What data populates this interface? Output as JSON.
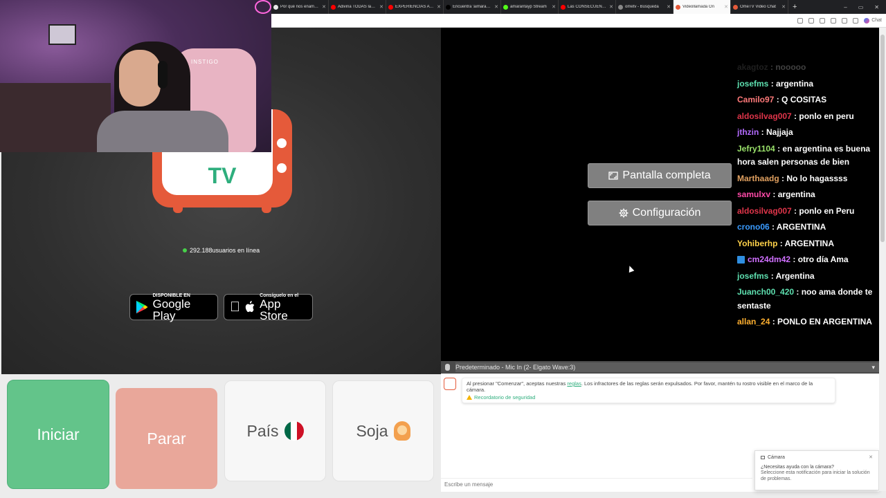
{
  "browser": {
    "tabs": [
      {
        "label": "Por qué nos enamora",
        "color": "#e8e8e8"
      },
      {
        "label": "Adivina TODAS las Ba",
        "color": "#ff0000"
      },
      {
        "label": "EXPERIENCIAS ATERR",
        "color": "#ff0000"
      },
      {
        "label": "Encuentra 'aimarant' c",
        "color": "#000000"
      },
      {
        "label": "amarantayp Stream",
        "color": "#53fc18"
      },
      {
        "label": "Las CONSECUENCIAS",
        "color": "#ff0000"
      },
      {
        "label": "ometv - Búsqueda",
        "color": "#888888"
      },
      {
        "label": "Videollamada On",
        "color": "#e55a3a",
        "active": true
      },
      {
        "label": "OmeTV Video Chat",
        "color": "#e55a3a"
      }
    ],
    "new_tab_symbol": "+",
    "window_controls": [
      "–",
      "▭",
      "✕"
    ],
    "copilot_label": "Chat"
  },
  "webcam": {
    "chair_brand": "INSTIGO"
  },
  "ometv": {
    "logo_text": "TV",
    "online_count": "292.188usuarios en línea",
    "google_play": {
      "small": "DISPONIBLE EN",
      "big": "Google Play"
    },
    "app_store": {
      "small": "Consíguelo en el",
      "big": "App Store"
    },
    "fullscreen_label": "Pantalla completa",
    "settings_label": "Configuración",
    "mic_device": "Predeterminado - Mic In (2- Elgato Wave:3)",
    "start_label": "Iniciar",
    "stop_label": "Parar",
    "country_label": "País",
    "gender_label": "Soja",
    "system_message": {
      "text_before": "Al presionar \"Comenzar\", aceptas nuestras ",
      "link": "reglas",
      "text_after": ". Los infractores de las reglas serán expulsados. Por favor, mantén tu rostro visible en el marco de la cámara.",
      "safety_link": "Recordatorio de seguridad"
    },
    "message_placeholder": "Escribe un mensaje",
    "notification": {
      "title": "Cámara",
      "question": "¿Necesitas ayuda con la cámara?",
      "body": "Seleccione esta notificación para iniciar la solución de problemas."
    }
  },
  "chat": [
    {
      "user": "akagtoz",
      "msg": " : nooooo",
      "color": "#7a7a7a",
      "faded": true
    },
    {
      "user": "josefms",
      "msg": " : argentina",
      "color": "#5ee0b0"
    },
    {
      "user": "Camilo97",
      "msg": " : Q COSITAS",
      "color": "#ff7a7a"
    },
    {
      "user": "aldosilvag007",
      "msg": " : ponlo en peru",
      "color": "#e0354a"
    },
    {
      "user": "jthzin",
      "msg": " : Najjaja",
      "color": "#b36bff"
    },
    {
      "user": "Jefry1104",
      "msg": " : en argentina es buena hora salen personas de bien",
      "color": "#9be36b"
    },
    {
      "user": "Marthaadg",
      "msg": " : No lo hagassss",
      "color": "#e0a060"
    },
    {
      "user": "samulxv",
      "msg": " : argentina",
      "color": "#ff4aa8"
    },
    {
      "user": "aldosilvag007",
      "msg": " : ponlo en Peru",
      "color": "#e0354a"
    },
    {
      "user": "crono06",
      "msg": " : ARGENTINA",
      "color": "#3a9bff"
    },
    {
      "user": "Yohiberhp",
      "msg": " : ARGENTINA",
      "color": "#ffd24a"
    },
    {
      "user": "cm24dm42",
      "msg": " : otro día Ama",
      "color": "#d070ff",
      "badge": true
    },
    {
      "user": "josefms",
      "msg": " : Argentina",
      "color": "#5ee0b0"
    },
    {
      "user": "Juanch00_420",
      "msg": " : noo ama donde te sentaste",
      "color": "#5ee0b0"
    },
    {
      "user": "allan_24",
      "msg": " : PONLO EN ARGENTINA",
      "color": "#ffb030"
    }
  ],
  "colors": {
    "accent_green": "#2eae7d",
    "brand_orange": "#e55a3a",
    "start_green": "#63c48a",
    "stop_salmon": "#e9a79a"
  }
}
